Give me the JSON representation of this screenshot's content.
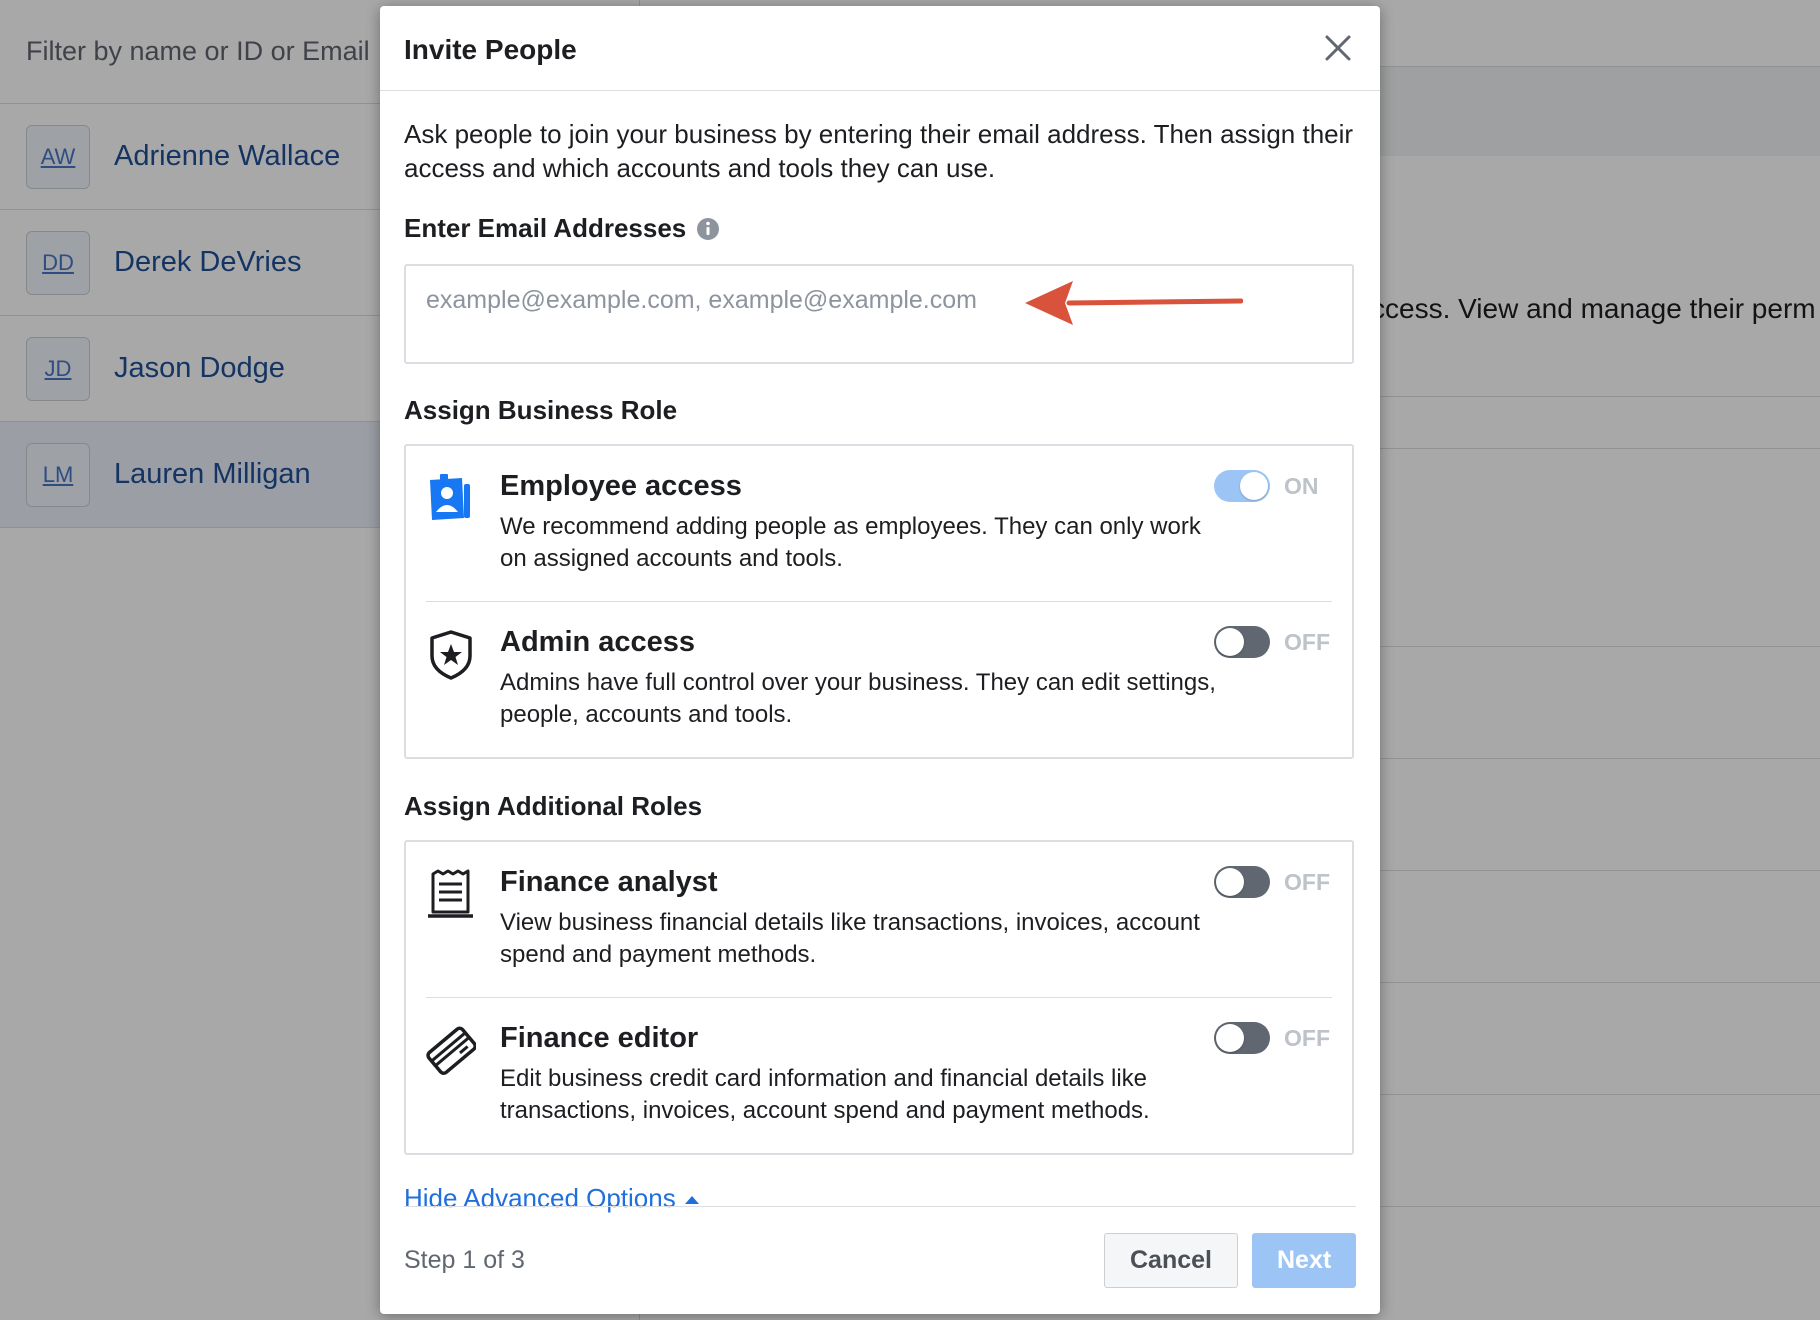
{
  "background": {
    "filter_placeholder": "Filter by name or ID or Email",
    "people": [
      {
        "initials": "AW",
        "name": "Adrienne Wallace"
      },
      {
        "initials": "DD",
        "name": "Derek DeVries"
      },
      {
        "initials": "JD",
        "name": "Jason Dodge"
      },
      {
        "initials": "LM",
        "name": "Lauren Milligan"
      }
    ],
    "right_text": "ccess. View and manage their perm"
  },
  "modal": {
    "title": "Invite People",
    "intro": "Ask people to join your business by entering their email address. Then assign their access and which accounts and tools they can use.",
    "email_label": "Enter Email Addresses",
    "email_placeholder": "example@example.com, example@example.com",
    "email_value": "",
    "business_role_label": "Assign Business Role",
    "business_roles": [
      {
        "title": "Employee access",
        "desc": "We recommend adding people as employees. They can only work on assigned accounts and tools.",
        "state": "ON",
        "icon": "id-badge-icon"
      },
      {
        "title": "Admin access",
        "desc": "Admins have full control over your business. They can edit settings, people, accounts and tools.",
        "state": "OFF",
        "icon": "shield-star-icon"
      }
    ],
    "additional_roles_label": "Assign Additional Roles",
    "additional_roles": [
      {
        "title": "Finance analyst",
        "desc": "View business financial details like transactions, invoices, account spend and payment methods.",
        "state": "OFF",
        "icon": "receipt-icon"
      },
      {
        "title": "Finance editor",
        "desc": "Edit business credit card information and financial details like transactions, invoices, account spend and payment methods.",
        "state": "OFF",
        "icon": "credit-card-icon"
      }
    ],
    "advanced_link": "Hide Advanced Options",
    "step_text": "Step 1 of 3",
    "cancel_label": "Cancel",
    "next_label": "Next"
  },
  "colors": {
    "link": "#216fdb",
    "toggle_on": "#9cc5f5",
    "toggle_off": "#606770",
    "arrow": "#d9533c"
  }
}
